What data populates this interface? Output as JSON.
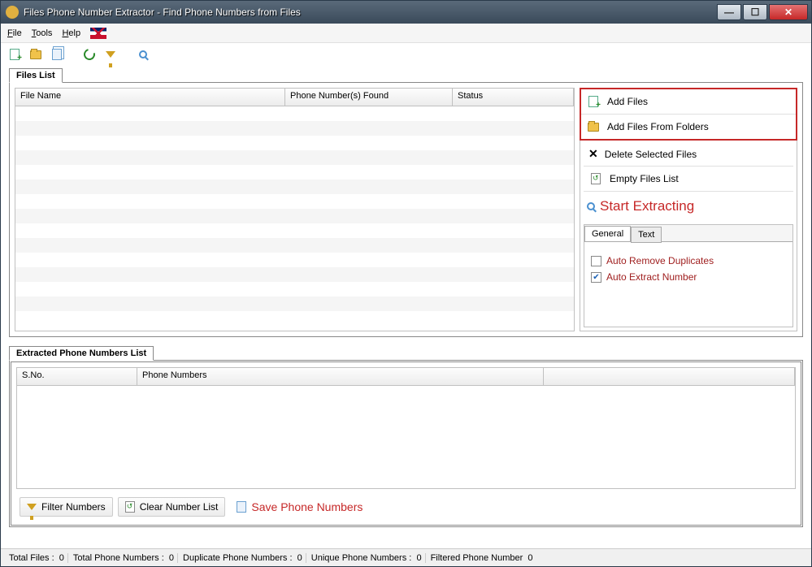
{
  "window": {
    "title": "Files Phone Number Extractor - Find Phone Numbers from Files"
  },
  "menu": {
    "file": "File",
    "tools": "Tools",
    "help": "Help"
  },
  "filesListTab": "Files List",
  "filesTable": {
    "col_filename": "File Name",
    "col_phonefound": "Phone Number(s) Found",
    "col_status": "Status"
  },
  "actions": {
    "addFiles": "Add Files",
    "addFolders": "Add Files From Folders",
    "deleteSelected": "Delete Selected Files",
    "emptyList": "Empty Files List",
    "startExtract": "Start Extracting"
  },
  "optTabs": {
    "general": "General",
    "text": "Text"
  },
  "options": {
    "autoRemoveDup": "Auto Remove Duplicates",
    "autoExtractNum": "Auto Extract Number"
  },
  "extractedTab": "Extracted Phone Numbers List",
  "extractedTable": {
    "col_sno": "S.No.",
    "col_phone": "Phone Numbers"
  },
  "buttons": {
    "filter": "Filter Numbers",
    "clear": "Clear Number List",
    "save": "Save Phone Numbers"
  },
  "status": {
    "totalFilesLabel": "Total Files :",
    "totalFilesVal": "0",
    "totalPhoneLabel": "Total Phone Numbers :",
    "totalPhoneVal": "0",
    "dupLabel": "Duplicate Phone Numbers :",
    "dupVal": "0",
    "uniqLabel": "Unique Phone Numbers :",
    "uniqVal": "0",
    "filteredLabel": "Filtered Phone Number",
    "filteredVal": "0"
  }
}
